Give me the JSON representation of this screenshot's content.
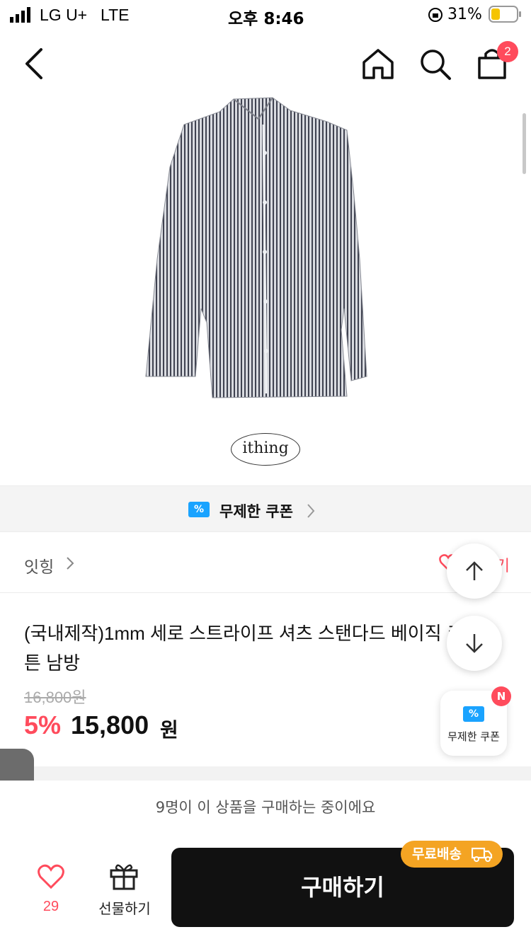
{
  "status_bar": {
    "carrier": "LG U+",
    "network": "LTE",
    "time": "오후 8:46",
    "battery": "31%"
  },
  "header": {
    "cart_count": "2",
    "icons": [
      "back-icon",
      "home-icon",
      "search-icon",
      "cart-icon"
    ]
  },
  "hero": {
    "brand_logo": "ithing"
  },
  "coupon_strip": {
    "label": "무제한 쿠폰",
    "ticket_symbol": "%"
  },
  "store": {
    "name": "잇힝",
    "like_text": "찜하기"
  },
  "product": {
    "title": "(국내제작)1mm 세로 스트라이프 셔츠 스탠다드 베이직 코튼 남방",
    "original_price": "16,800원",
    "discount": "5%",
    "price": "15,800",
    "currency": "원"
  },
  "floating": {
    "coupon_label": "무제한 쿠폰",
    "new_badge": "N"
  },
  "viewers_text": "9명이 이 상품을 구매하는 중이에요",
  "bottom": {
    "like_count": "29",
    "gift_label": "선물하기",
    "buy_label": "구매하기",
    "free_shipping": "무료배송"
  },
  "colors": {
    "accent": "#ff4b5c",
    "coupon_blue": "#1aa3ff",
    "ship_orange": "#f4a423",
    "buy_bg": "#111111"
  }
}
